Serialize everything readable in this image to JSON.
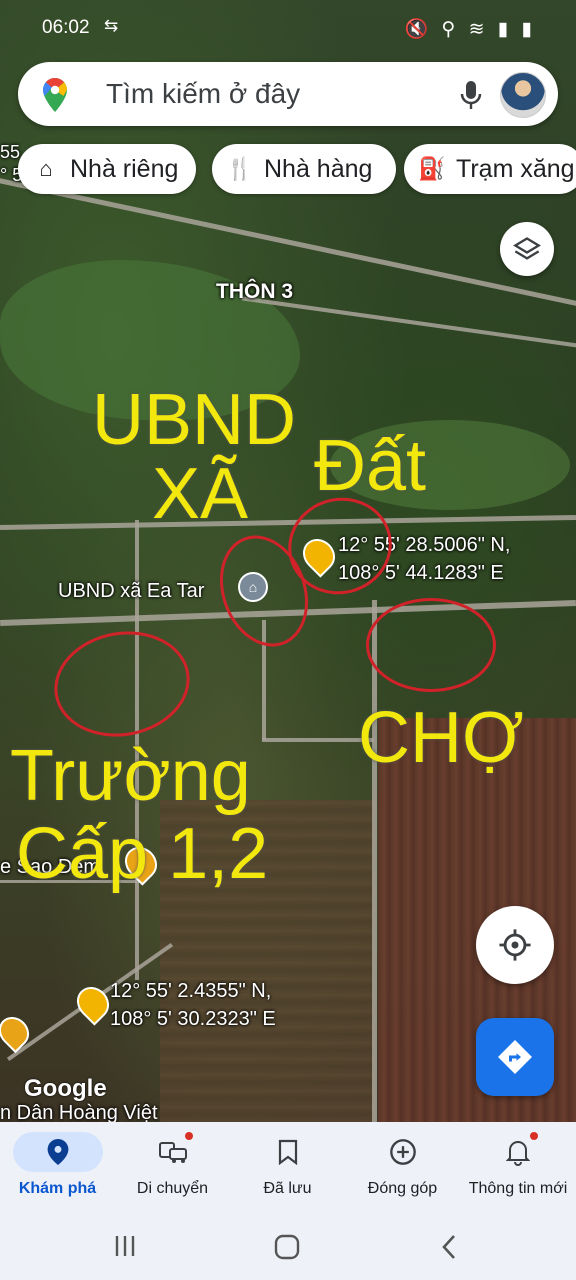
{
  "status_bar": {
    "time": "06:02"
  },
  "search": {
    "placeholder": "Tìm kiếm ở đây"
  },
  "chips": [
    {
      "label": "Nhà riêng",
      "icon": "home-icon"
    },
    {
      "label": "Nhà hàng",
      "icon": "restaurant-icon"
    },
    {
      "label": "Trạm xăng",
      "icon": "gas-station-icon"
    }
  ],
  "map": {
    "labels": {
      "thon": "THÔN 3",
      "ubnd_place": "UBND xã Ea Tar",
      "cafe": "e Sao Đêm",
      "bottom": "n Dân Hoàng Việt",
      "google": "Google",
      "coord1_line1": "12° 55' 28.5006\" N,",
      "coord1_line2": "108° 5' 44.1283\" E",
      "coord2_line1": "12° 55' 2.4355\" N,",
      "coord2_line2": "108° 5' 30.2323\" E",
      "edge_left_top": "55",
      "edge_left_top2": "° 5"
    },
    "annotations": {
      "ubnd_line1": "UBND",
      "ubnd_line2": "XÃ",
      "dat": "Đất",
      "cho": "CHỢ",
      "truong_line1": "Trường",
      "truong_line2": "Cấp 1,2"
    }
  },
  "bottom_nav": [
    {
      "label": "Khám phá",
      "icon": "explore-pin-icon",
      "active": true
    },
    {
      "label": "Di chuyển",
      "icon": "commute-icon",
      "badge": true
    },
    {
      "label": "Đã lưu",
      "icon": "bookmark-icon"
    },
    {
      "label": "Đóng góp",
      "icon": "add-circle-icon"
    },
    {
      "label": "Thông tin mới",
      "icon": "bell-icon",
      "badge": true
    }
  ],
  "colors": {
    "accent": "#1a73e8",
    "annotation": "#f3e80e",
    "ring": "#d1222a"
  }
}
